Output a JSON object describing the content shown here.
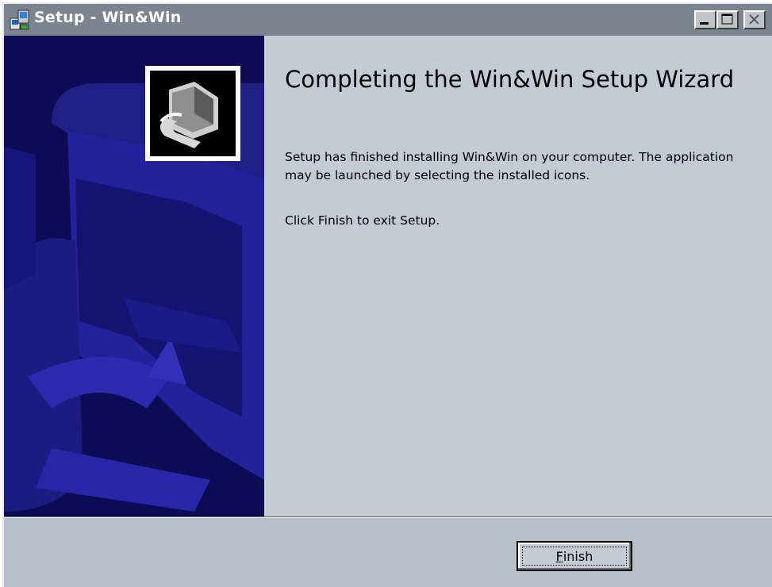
{
  "window": {
    "title": "Setup - Win&Win",
    "app_icon": "setup-icon"
  },
  "titlebar_buttons": {
    "minimize_icon": "minimize-icon",
    "maximize_icon": "maximize-icon",
    "close_icon": "close-icon"
  },
  "banner": {
    "icon": "computer-install-icon",
    "colors": {
      "background": "#0c0c55",
      "shapes": "#2a2a9e"
    }
  },
  "content": {
    "heading": "Completing the Win&Win Setup Wizard",
    "paragraph1": "Setup has finished installing Win&Win on your computer. The application may be launched by selecting the installed icons.",
    "paragraph2": "Click Finish to exit Setup."
  },
  "footer": {
    "finish_mnemonic": "F",
    "finish_rest": "inish"
  },
  "colors": {
    "titlebar": "#7b8590",
    "content_background": "#c3ccd4",
    "footer_background": "#b8c1cb"
  }
}
